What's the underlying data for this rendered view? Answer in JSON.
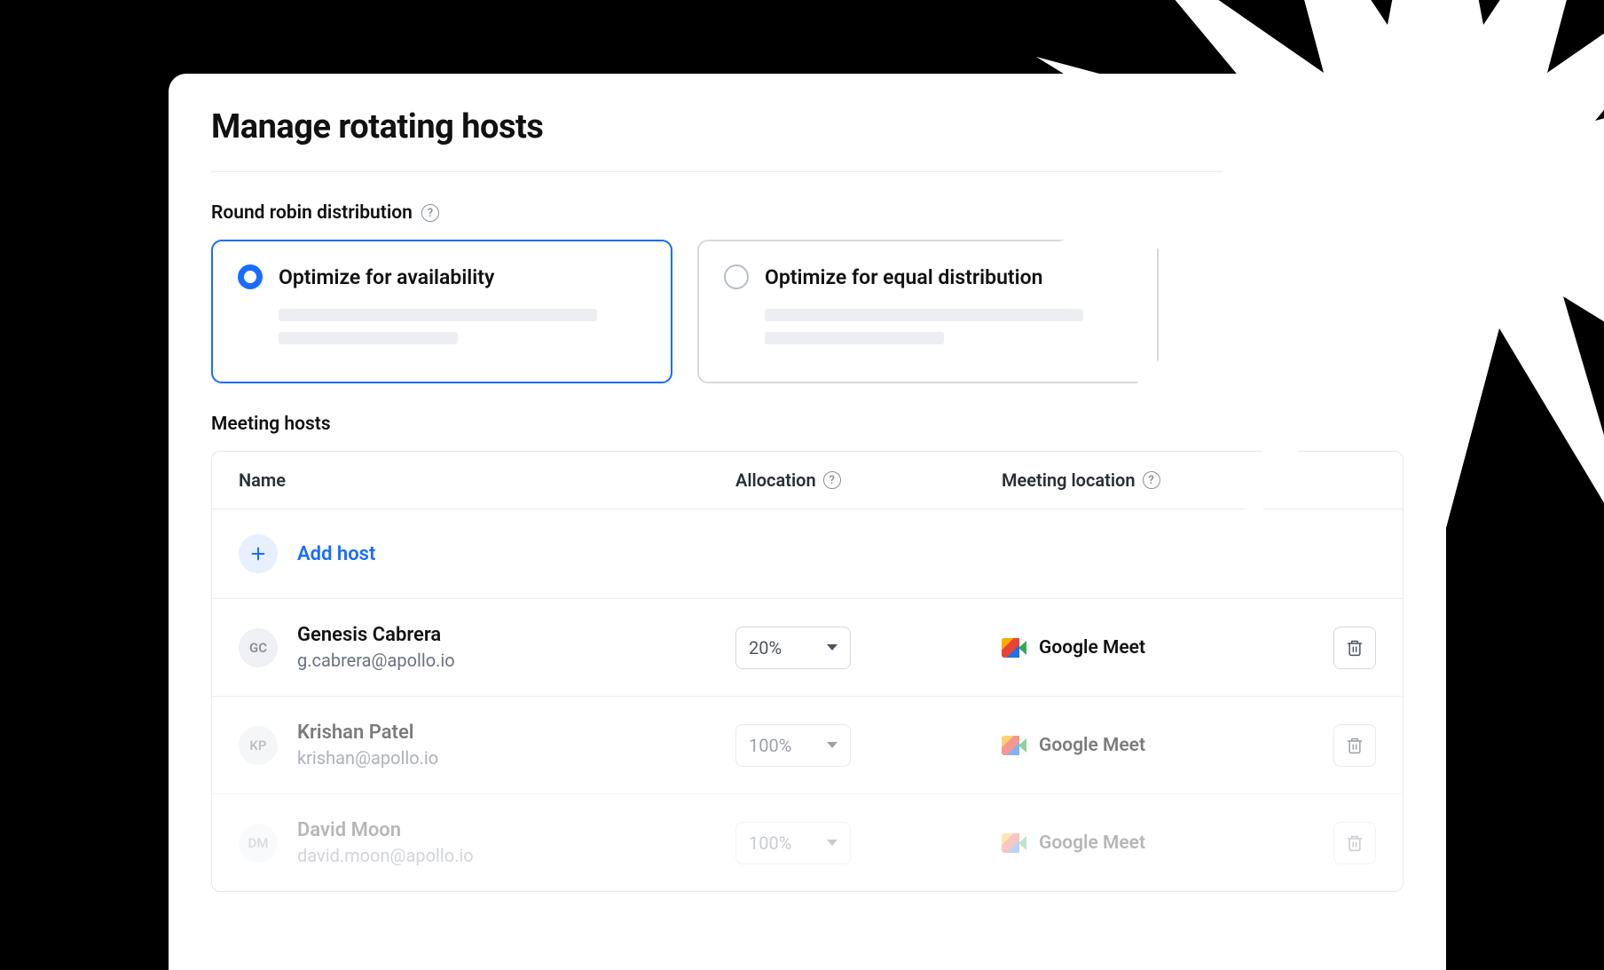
{
  "page_title": "Manage rotating hosts",
  "distribution": {
    "section_label": "Round robin distribution",
    "options": {
      "availability": {
        "label": "Optimize for availability",
        "selected": true
      },
      "equal": {
        "label": "Optimize for equal distribution",
        "selected": false
      }
    }
  },
  "hosts": {
    "section_label": "Meeting hosts",
    "columns": {
      "name": "Name",
      "allocation": "Allocation",
      "location": "Meeting location"
    },
    "add_host_label": "Add host",
    "rows": [
      {
        "initials": "GC",
        "name": "Genesis Cabrera",
        "email": "g.cabrera@apollo.io",
        "allocation": "20%",
        "location": "Google Meet"
      },
      {
        "initials": "KP",
        "name": "Krishan Patel",
        "email": "krishan@apollo.io",
        "allocation": "100%",
        "location": "Google Meet"
      },
      {
        "initials": "DM",
        "name": "David Moon",
        "email": "david.moon@apollo.io",
        "allocation": "100%",
        "location": "Google Meet"
      }
    ]
  }
}
